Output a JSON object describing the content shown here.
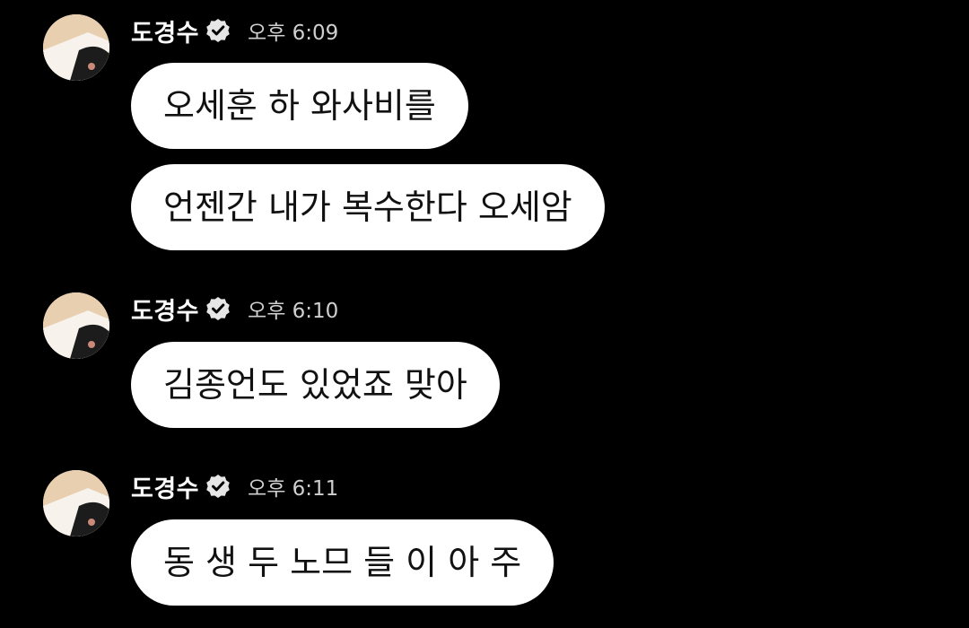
{
  "messages": [
    {
      "sender": "도경수",
      "time": "오후 6:09",
      "bubbles": [
        "오세훈 하 와사비를",
        "언젠간 내가 복수한다 오세암"
      ]
    },
    {
      "sender": "도경수",
      "time": "오후 6:10",
      "bubbles": [
        "김종언도 있었죠 맞아"
      ]
    },
    {
      "sender": "도경수",
      "time": "오후 6:11",
      "bubbles": [
        "동 생 두 노므 들 이 아 주"
      ]
    }
  ],
  "icons": {
    "verified": "verified-badge-icon",
    "avatar": "profile-avatar"
  },
  "colors": {
    "background": "#000000",
    "bubble": "#ffffff",
    "bubble_text": "#111111",
    "sender_text": "#ffffff",
    "time_text": "#cfcfcf"
  }
}
